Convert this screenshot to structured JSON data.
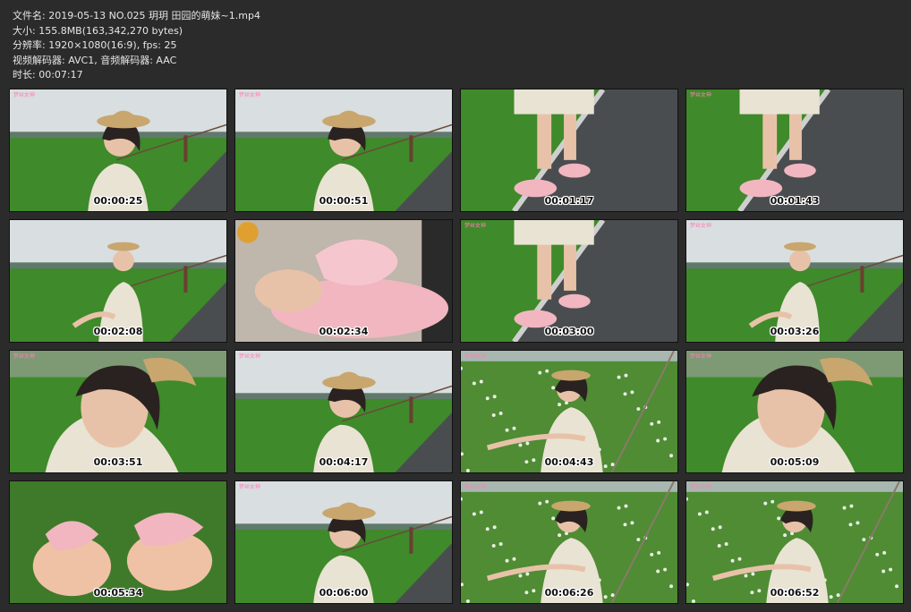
{
  "info": {
    "lines": [
      "文件名: 2019-05-13 NO.025 玥玥 田园的萌妹~1.mp4",
      "大小: 155.8MB(163,342,270 bytes)",
      "分辨率: 1920×1080(16:9), fps: 25",
      "视频解码器: AVC1, 音频解码器: AAC",
      "时长: 00:07:17"
    ]
  },
  "thumbnails": [
    {
      "time": "00:00:25",
      "scene": "field-portrait",
      "watermark": true
    },
    {
      "time": "00:00:51",
      "scene": "field-portrait",
      "watermark": true
    },
    {
      "time": "00:01:17",
      "scene": "road-feet",
      "watermark": false
    },
    {
      "time": "00:01:43",
      "scene": "road-feet",
      "watermark": true
    },
    {
      "time": "00:02:08",
      "scene": "field-sitting",
      "watermark": false
    },
    {
      "time": "00:02:34",
      "scene": "sandal-closeup",
      "watermark": false
    },
    {
      "time": "00:03:00",
      "scene": "road-feet",
      "watermark": true
    },
    {
      "time": "00:03:26",
      "scene": "field-sitting",
      "watermark": true
    },
    {
      "time": "00:03:51",
      "scene": "face-closeup",
      "watermark": true
    },
    {
      "time": "00:04:17",
      "scene": "field-portrait",
      "watermark": true
    },
    {
      "time": "00:04:43",
      "scene": "clover-sitting",
      "watermark": true
    },
    {
      "time": "00:05:09",
      "scene": "face-closeup",
      "watermark": true
    },
    {
      "time": "00:05:34",
      "scene": "sandal-grass",
      "watermark": false
    },
    {
      "time": "00:06:00",
      "scene": "field-portrait",
      "watermark": true
    },
    {
      "time": "00:06:26",
      "scene": "clover-sitting",
      "watermark": true
    },
    {
      "time": "00:06:52",
      "scene": "clover-sitting",
      "watermark": true
    }
  ],
  "watermark_text": "梦丝女神",
  "colors": {
    "background": "#2b2b2b",
    "info_text": "#e6e6e6",
    "sky": "#d9dee0",
    "grass": "#3f8a2a",
    "road": "#4a4d50",
    "skin": "#e8c2a8",
    "dress": "#e9e3d4",
    "hat": "#c8a66e",
    "sandal": "#f1b6c0",
    "hair": "#2a2220"
  }
}
